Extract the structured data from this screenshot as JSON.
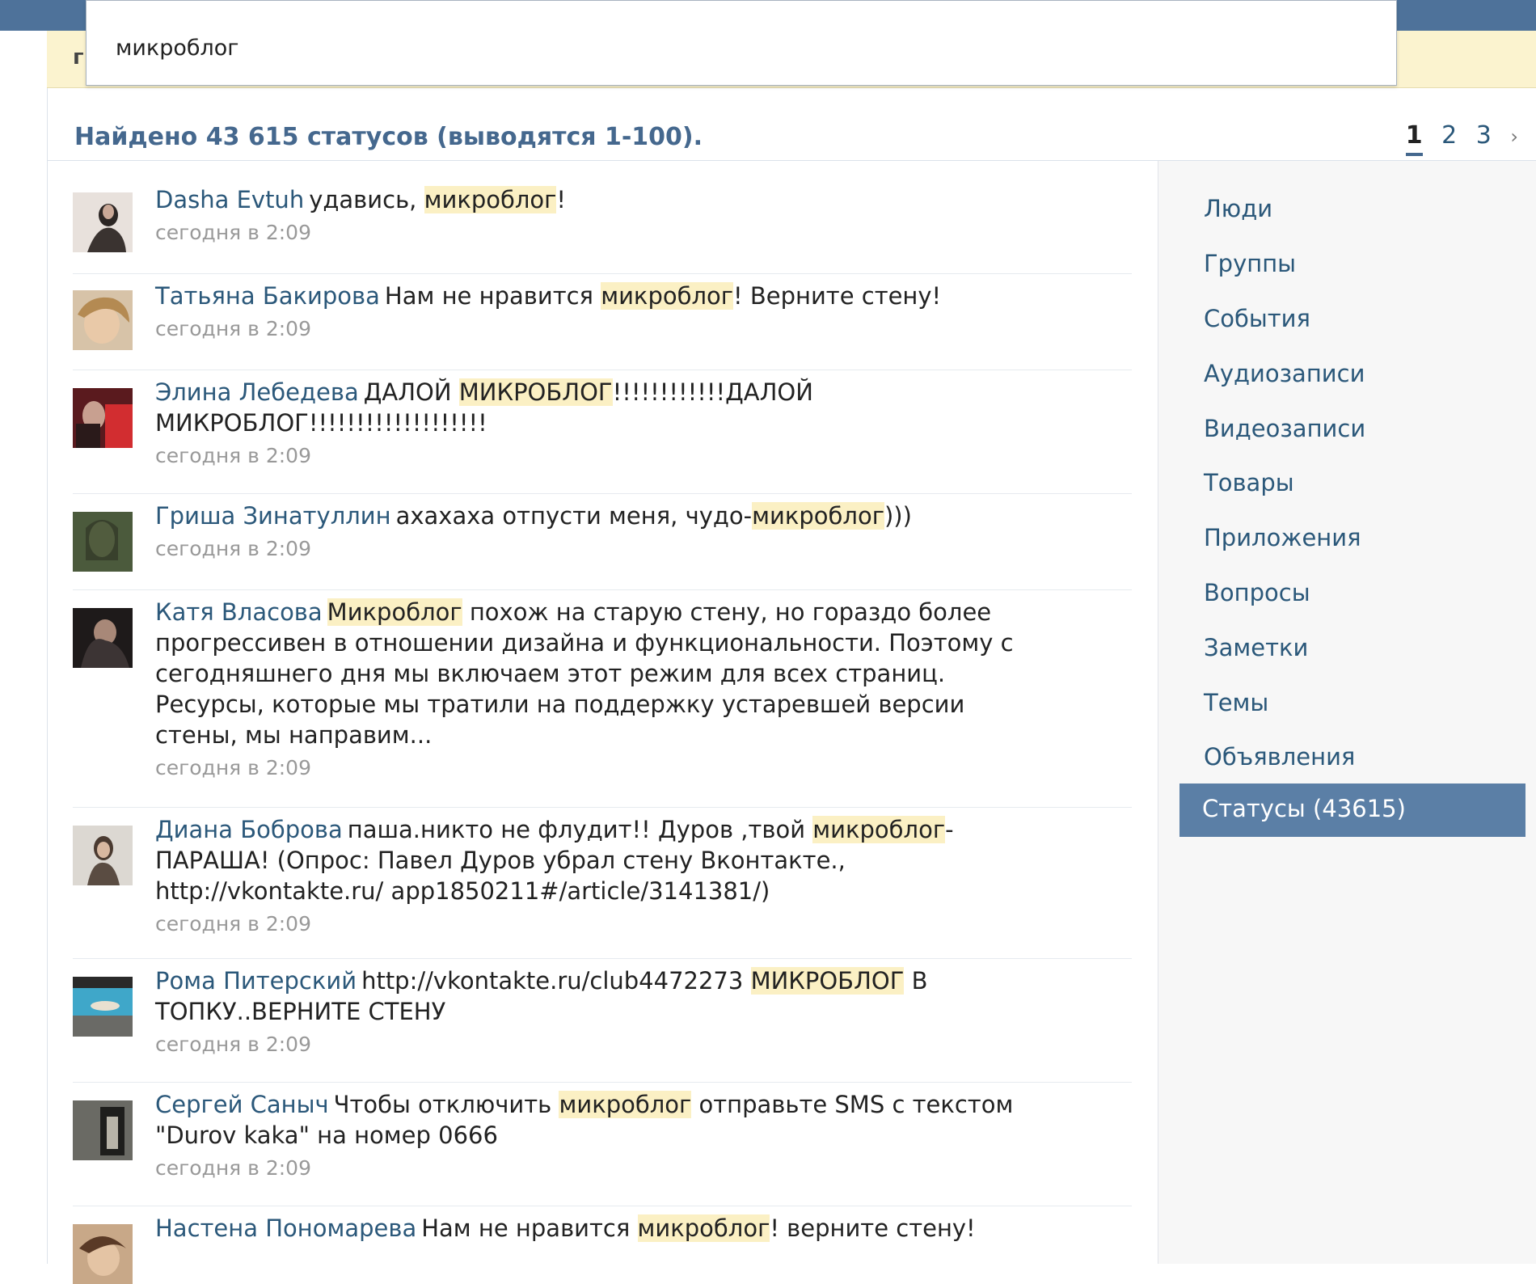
{
  "search": {
    "value": "микроблог"
  },
  "summary": "Найдено 43 615 статусов (выводятся 1-100).",
  "pagination": {
    "current": "1",
    "pages": [
      "2",
      "3"
    ],
    "next": "›"
  },
  "sidebar": {
    "items": [
      "Люди",
      "Группы",
      "События",
      "Аудиозаписи",
      "Видеозаписи",
      "Товары",
      "Приложения",
      "Вопросы",
      "Заметки",
      "Темы",
      "Объявления"
    ],
    "active": "Статусы (43615)"
  },
  "results": [
    {
      "author": "Dasha Evtuh",
      "pre": "удавись, ",
      "hl": "микроблог",
      "post": "!",
      "time": "сегодня в 2:09"
    },
    {
      "author": "Татьяна Бакирова",
      "pre": "Нам не нравится ",
      "hl": "микроблог",
      "post": "! Верните стену!",
      "time": "сегодня в 2:09"
    },
    {
      "author": "Элина Лебедева",
      "pre": "ДАЛОЙ ",
      "hl": "МИКРОБЛОГ",
      "post": "!!!!!!!!!!!!ДАЛОЙ МИКРОБЛОГ!!!!!!!!!!!!!!!!!!!",
      "time": "сегодня в 2:09"
    },
    {
      "author": "Гриша Зинатуллин",
      "pre": "ахахаха отпусти меня, чудо-",
      "hl": "микроблог",
      "post": ")))",
      "time": "сегодня в 2:09"
    },
    {
      "author": "Катя Власова",
      "pre": "",
      "hl": "Микроблог",
      "post": " похож на старую стену, но гораздо более прогрессивен в отношении дизайна и функциональности. Поэтому с сегодняшнего дня мы включаем этот режим для всех страниц. Ресурсы, которые мы тратили на поддержку устаревшей версии стены, мы направим...",
      "time": "сегодня в 2:09"
    },
    {
      "author": "Диана Боброва",
      "pre": "паша.никто не флудит!! Дуров ,твой ",
      "hl": "микроблог",
      "post": "-ПАРАША! (Опрос: Павел Дуров убрал стену Вконтакте., http://vkontakte.ru/ app1850211#/article/3141381/)",
      "time": "сегодня в 2:09"
    },
    {
      "author": "Рома Питерский",
      "pre": "http://vkontakte.ru/club4472273 ",
      "hl": "МИКРОБЛОГ",
      "post": " В ТОПКУ..ВЕРНИТЕ СТЕНУ",
      "time": "сегодня в 2:09"
    },
    {
      "author": "Сергей Саныч",
      "pre": "Чтобы отключить ",
      "hl": "микроблог",
      "post": " отправьте SMS с текстом \"Durov kaka\" на номер 0666",
      "time": "сегодня в 2:09"
    },
    {
      "author": "Настена Пономарева",
      "pre": "Нам не нравится ",
      "hl": "микроблог",
      "post": "! верните стену!",
      "time": ""
    }
  ]
}
